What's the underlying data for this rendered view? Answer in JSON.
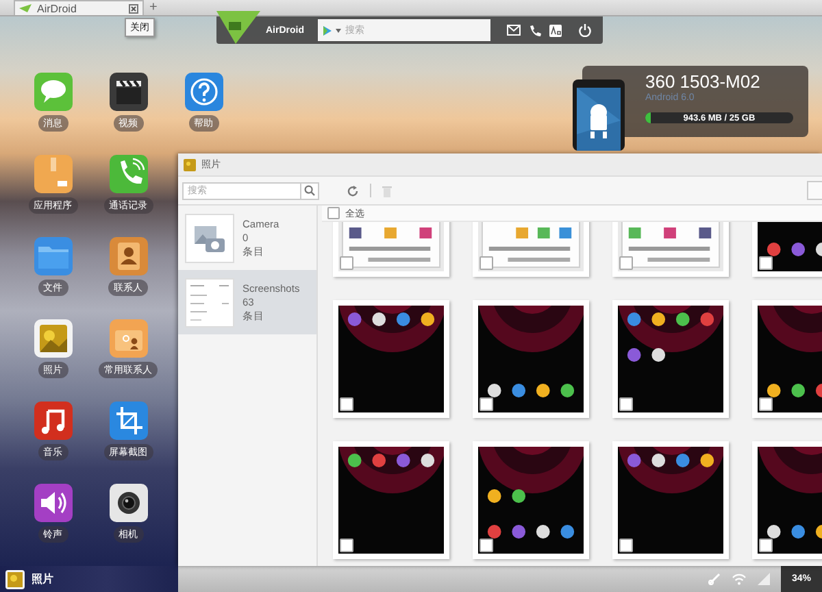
{
  "browser_tab": {
    "title": "AirDroid",
    "selected": true,
    "tooltip": "关闭"
  },
  "new_tab": "+",
  "toolbar": {
    "brand": "AirDroid",
    "search_placeholder": "搜索"
  },
  "apps": [
    {
      "label": "消息",
      "kind": "message"
    },
    {
      "label": "视频",
      "kind": "video"
    },
    {
      "label": "帮助",
      "kind": "help"
    },
    {
      "label": "应用程序",
      "kind": "apps"
    },
    {
      "label": "通话记录",
      "kind": "calls"
    },
    {
      "label": "文件",
      "kind": "files"
    },
    {
      "label": "联系人",
      "kind": "contacts"
    },
    {
      "label": "照片",
      "kind": "photos"
    },
    {
      "label": "常用联系人",
      "kind": "favorites"
    },
    {
      "label": "音乐",
      "kind": "music"
    },
    {
      "label": "屏幕截图",
      "kind": "screenshot"
    },
    {
      "label": "铃声",
      "kind": "ringtone"
    },
    {
      "label": "相机",
      "kind": "camera"
    }
  ],
  "device": {
    "name": "360 1503-M02",
    "os": "Android 6.0",
    "storage": "943.6 MB / 25 GB",
    "level": 0.04
  },
  "photo_window": {
    "title": "照片",
    "search_placeholder": "搜索",
    "select_all": {
      "label": "全选",
      "checked": false
    },
    "albums": [
      {
        "name": "Camera",
        "count": "0",
        "unit": "条目",
        "kind": "empty",
        "selected": false
      },
      {
        "name": "Screenshots",
        "count": "63",
        "unit": "条目",
        "kind": "list",
        "selected": true
      }
    ],
    "photos": [
      {
        "kind": "light",
        "checked": false
      },
      {
        "kind": "light",
        "checked": false
      },
      {
        "kind": "light",
        "checked": false
      },
      {
        "kind": "dark",
        "checked": false
      },
      {
        "kind": "dark",
        "checked": false
      },
      {
        "kind": "dark",
        "checked": false
      },
      {
        "kind": "dark",
        "checked": false
      },
      {
        "kind": "dark",
        "checked": false
      },
      {
        "kind": "dark",
        "checked": false
      },
      {
        "kind": "dark",
        "checked": false
      },
      {
        "kind": "dark",
        "checked": false
      },
      {
        "kind": "dark",
        "checked": false
      }
    ]
  },
  "taskbar": {
    "app": "照片",
    "battery": "34%"
  }
}
